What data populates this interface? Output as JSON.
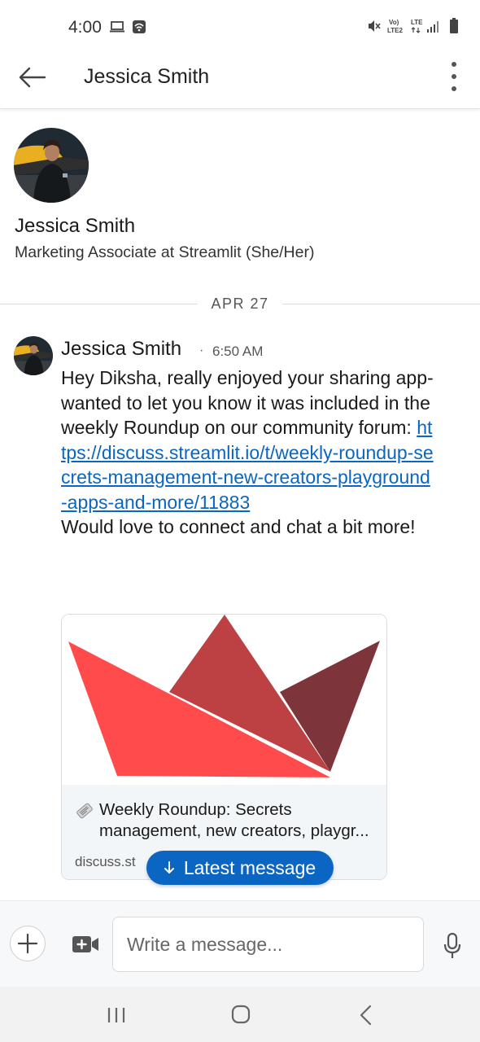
{
  "status_bar": {
    "time": "4:00",
    "icons": [
      "laptop-icon",
      "wifi-calling-icon",
      "mute-icon",
      "volte-icon",
      "lte-signal-icon",
      "battery-icon"
    ]
  },
  "header": {
    "title": "Jessica Smith",
    "icons": [
      "back-arrow-icon",
      "more-vertical-icon"
    ]
  },
  "profile": {
    "name": "Jessica Smith",
    "headline": "Marketing Associate at Streamlit (She/Her)"
  },
  "date_divider": "APR 27",
  "message": {
    "sender": "Jessica Smith",
    "separator": "·",
    "time": "6:50 AM",
    "text_before_link": "Hey Diksha, really enjoyed your sharing app- wanted to let you know it was included in the weekly Roundup on our community forum: ",
    "link": "https://discuss.streamlit.io/t/weekly-roundup-secrets-management-new-creators-playground-apps-and-more/11883",
    "text_after_link": "Would love to connect and chat a bit more!"
  },
  "link_preview": {
    "icon": "newspaper-icon",
    "title": "Weekly Roundup: Secrets management, new creators, playgr...",
    "domain": "discuss.st"
  },
  "latest_message_button": {
    "label": "Latest message",
    "icon": "arrow-down-icon"
  },
  "composer": {
    "placeholder": "Write a message...",
    "icons": [
      "plus-icon",
      "video-add-icon",
      "mic-icon"
    ]
  },
  "nav_bar": {
    "icons": [
      "recents-icon",
      "home-icon",
      "back-icon"
    ]
  },
  "colors": {
    "link": "#0a66c2",
    "accent": "#0a66c2",
    "streamlit_red": "#ff4b4b",
    "streamlit_mid": "#bd4043",
    "streamlit_dark": "#7d353b"
  }
}
